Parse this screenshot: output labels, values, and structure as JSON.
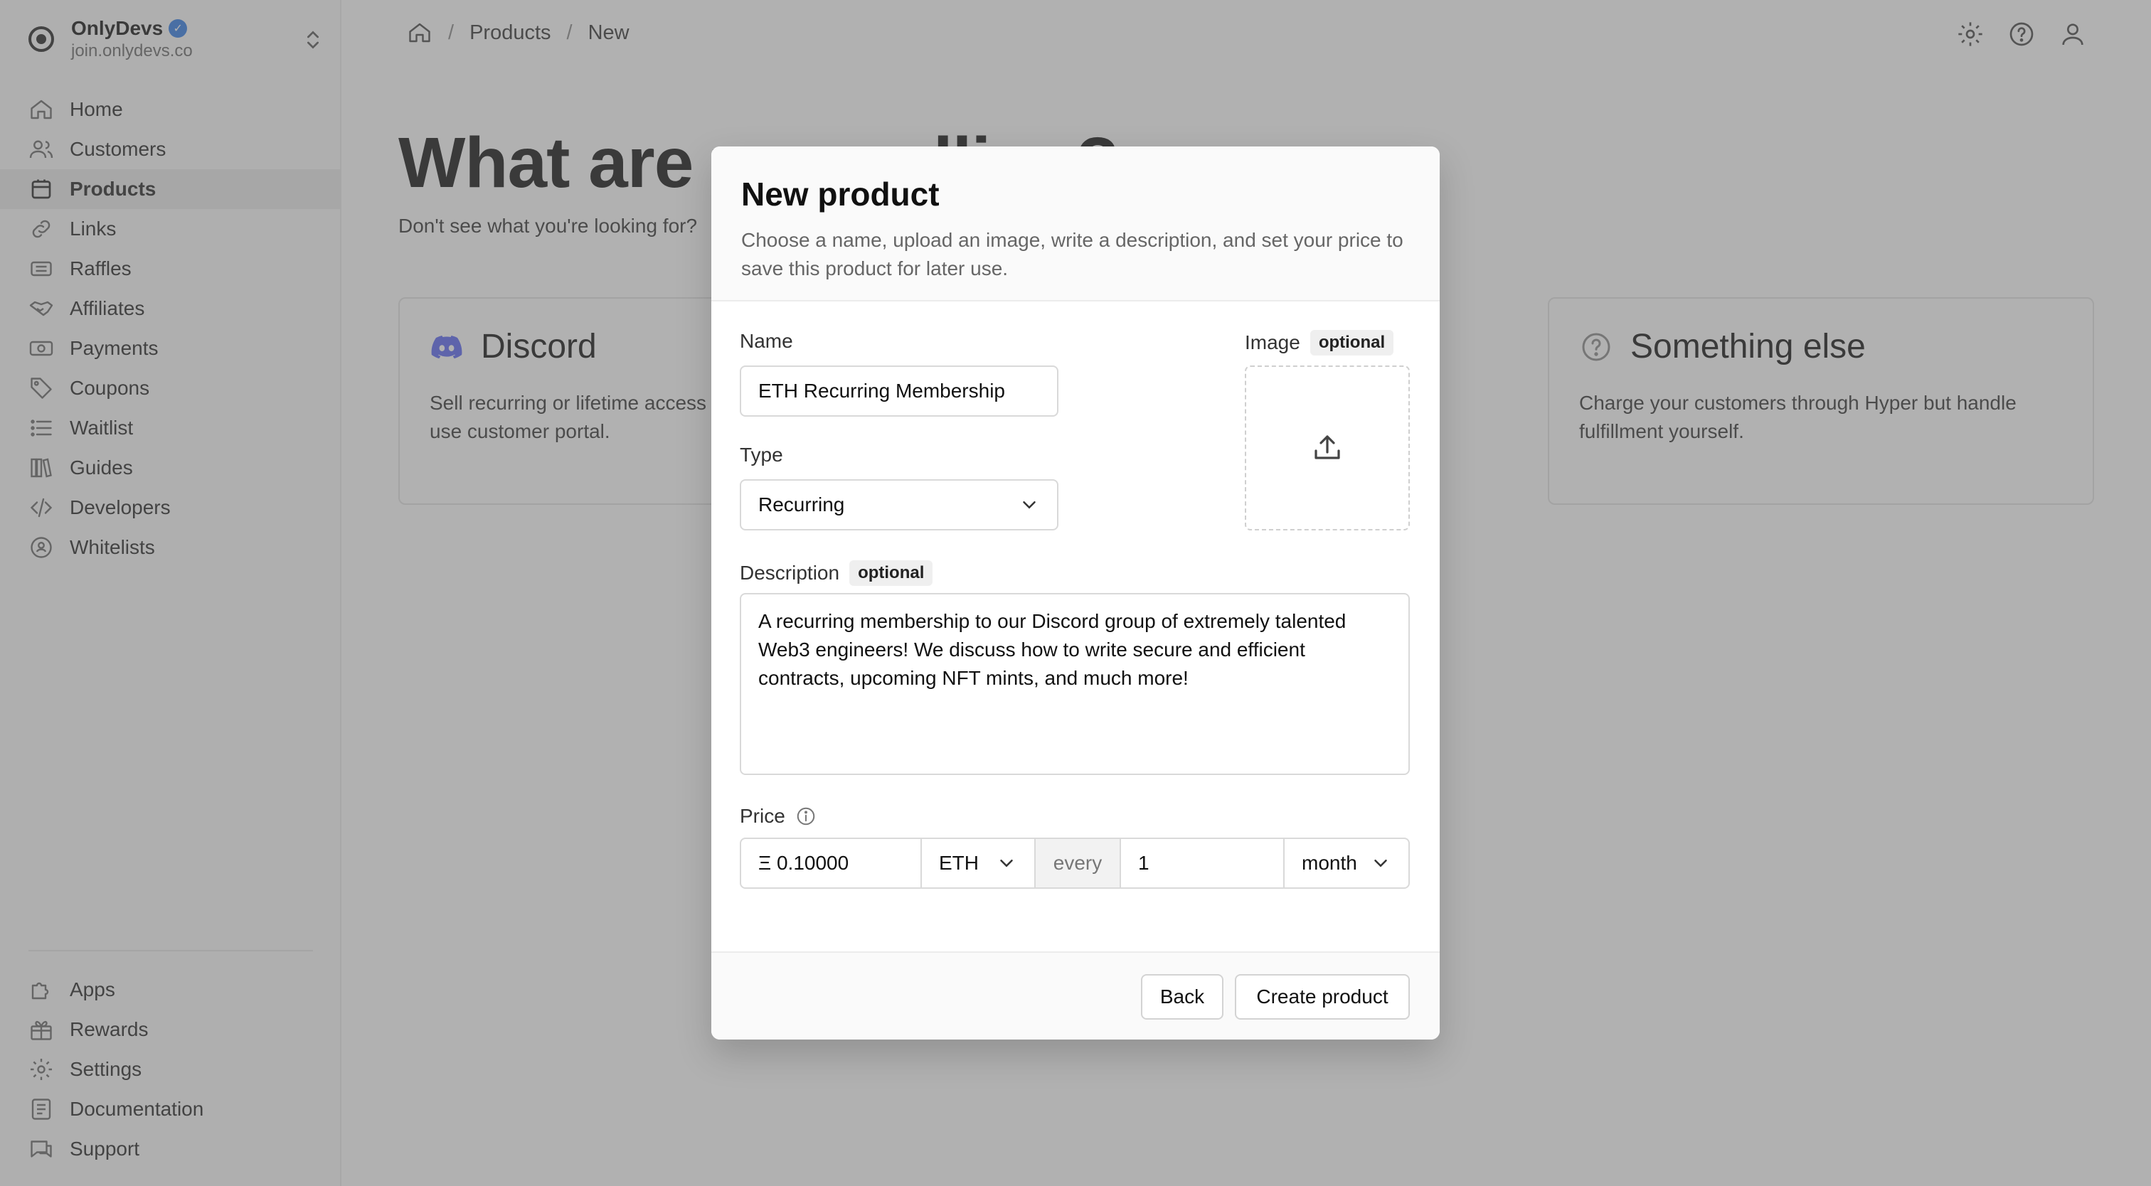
{
  "org": {
    "name": "OnlyDevs",
    "domain": "join.onlydevs.co"
  },
  "sidebar": {
    "items": [
      {
        "label": "Home",
        "icon": "home-icon"
      },
      {
        "label": "Customers",
        "icon": "users-icon"
      },
      {
        "label": "Products",
        "icon": "box-icon",
        "active": true
      },
      {
        "label": "Links",
        "icon": "link-icon"
      },
      {
        "label": "Raffles",
        "icon": "ticket-icon"
      },
      {
        "label": "Affiliates",
        "icon": "handshake-icon"
      },
      {
        "label": "Payments",
        "icon": "cash-icon"
      },
      {
        "label": "Coupons",
        "icon": "tag-icon"
      },
      {
        "label": "Waitlist",
        "icon": "list-icon"
      },
      {
        "label": "Guides",
        "icon": "books-icon"
      },
      {
        "label": "Developers",
        "icon": "code-icon"
      },
      {
        "label": "Whitelists",
        "icon": "badge-icon"
      }
    ],
    "bottom_items": [
      {
        "label": "Apps",
        "icon": "puzzle-icon"
      },
      {
        "label": "Rewards",
        "icon": "gift-icon"
      },
      {
        "label": "Settings",
        "icon": "gear-icon"
      },
      {
        "label": "Documentation",
        "icon": "doc-icon"
      },
      {
        "label": "Support",
        "icon": "chat-icon"
      }
    ]
  },
  "breadcrumb": {
    "items": [
      "Products",
      "New"
    ]
  },
  "page": {
    "title": "What are you selling?",
    "subtitle": "Don't see what you're looking for?",
    "cards": [
      {
        "title": "Discord",
        "body": "Sell recurring or lifetime access to your server through our seamless, easy to use customer portal."
      },
      {
        "title": "Something else",
        "body": "Charge your customers through Hyper but handle fulfillment yourself."
      }
    ]
  },
  "modal": {
    "title": "New product",
    "description": "Choose a name, upload an image, write a description, and set your price to save this product for later use.",
    "name_label": "Name",
    "name_value": "ETH Recurring Membership",
    "image_label": "Image",
    "optional_badge": "optional",
    "type_label": "Type",
    "type_value": "Recurring",
    "description_label": "Description",
    "description_value": "A recurring membership to our Discord group of extremely talented Web3 engineers! We discuss how to write secure and efficient contracts, upcoming NFT mints, and much more!",
    "price_label": "Price",
    "price_amount": "Ξ 0.10000",
    "price_currency": "ETH",
    "price_every": "every",
    "price_interval_count": "1",
    "price_interval_unit": "month",
    "back_label": "Back",
    "create_label": "Create product"
  },
  "colors": {
    "discord": "#5865F2",
    "verified": "#2F7BE5",
    "overlay": "rgba(100,100,100,0.5)"
  }
}
